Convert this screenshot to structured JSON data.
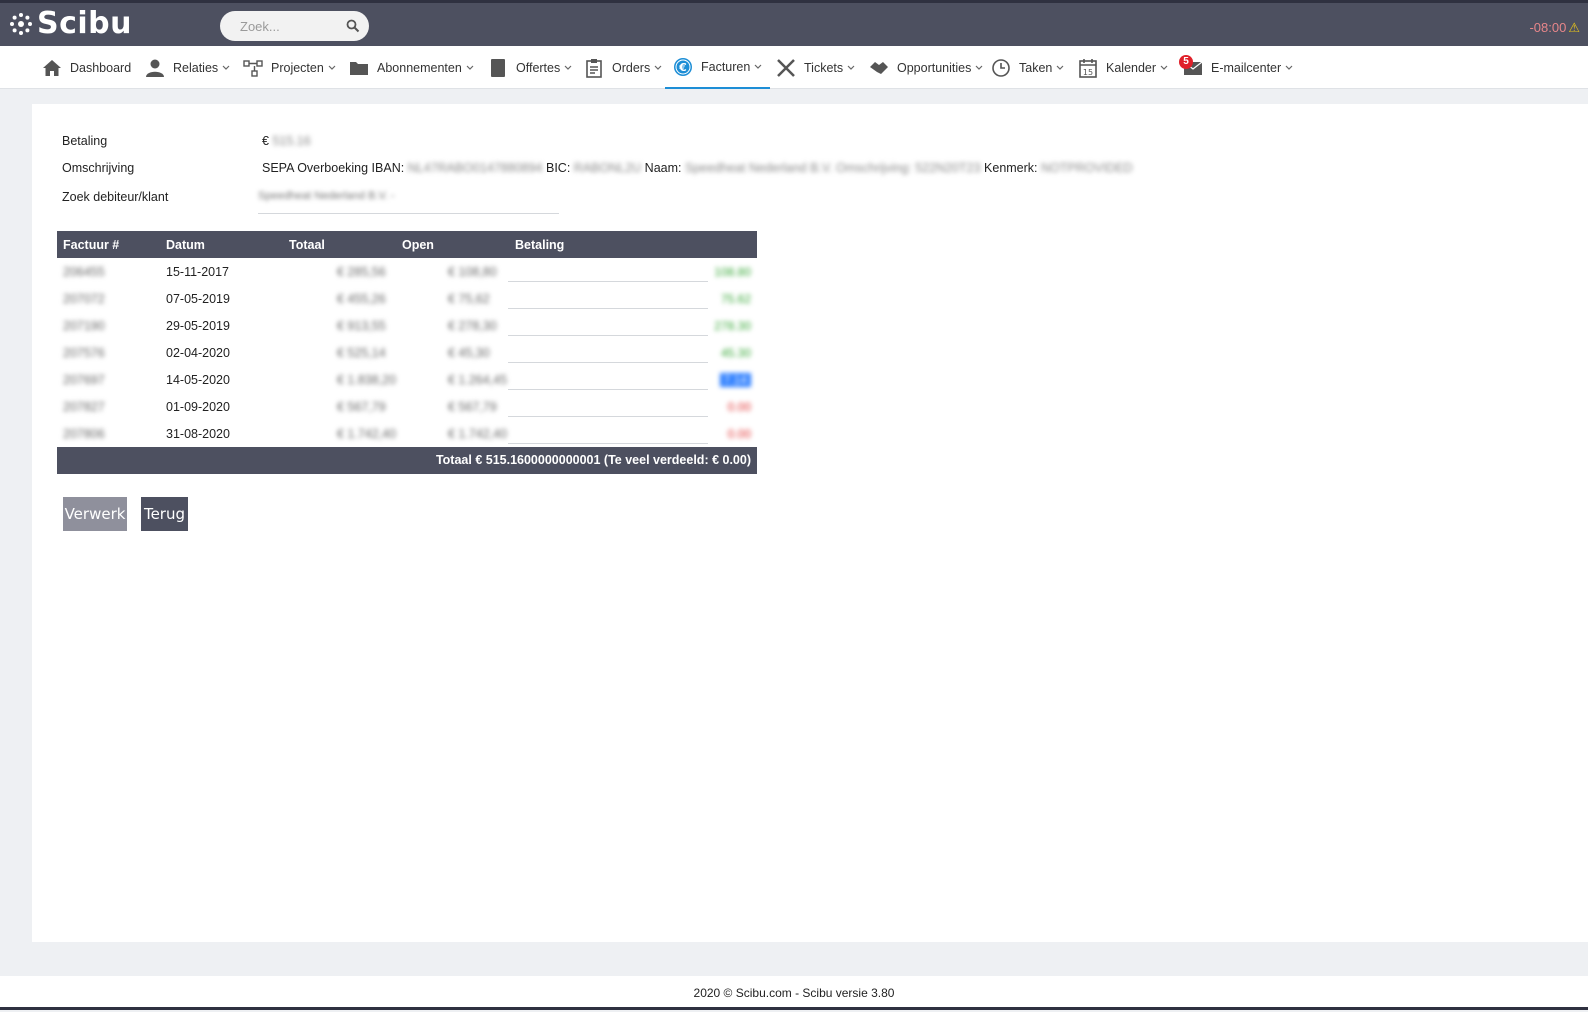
{
  "app": {
    "logo": "Scibu"
  },
  "search": {
    "placeholder": "Zoek..."
  },
  "header": {
    "time": "-08:00"
  },
  "nav": {
    "dashboard": "Dashboard",
    "relaties": "Relaties",
    "projecten": "Projecten",
    "abonnementen": "Abonnementen",
    "offertes": "Offertes",
    "orders": "Orders",
    "facturen": "Facturen",
    "tickets": "Tickets",
    "opportunities": "Opportunities",
    "taken": "Taken",
    "kalender": "Kalender",
    "emailcenter": "E-mailcenter",
    "email_badge": "5"
  },
  "form": {
    "betaling_label": "Betaling",
    "betaling_currency": "€",
    "betaling_value": "515.16",
    "omschrijving_label": "Omschrijving",
    "omschrijving_prefix": "SEPA Overboeking IBAN:",
    "iban": "NL47RABO0147880894",
    "bic_label": "BIC:",
    "bic": "RABONL2U",
    "naam_label": "Naam:",
    "naam": "Speedheat Nederland B.V. Omschrijving: 522N20T23",
    "kenmerk_label": "Kenmerk:",
    "kenmerk": "NOTPROVIDED",
    "zoek_label": "Zoek debiteur/klant",
    "zoek_value": "Speedheat Nederland B.V. -"
  },
  "table": {
    "headers": {
      "factuur": "Factuur #",
      "datum": "Datum",
      "totaal": "Totaal",
      "open": "Open",
      "betaling": "Betaling"
    },
    "rows": [
      {
        "factuur": "206455",
        "datum": "15-11-2017",
        "totaal": "€ 285,56",
        "open": "€ 108,80",
        "betaling": "108.80"
      },
      {
        "factuur": "207072",
        "datum": "07-05-2019",
        "totaal": "€ 455,26",
        "open": "€ 75,62",
        "betaling": "75.62"
      },
      {
        "factuur": "207190",
        "datum": "29-05-2019",
        "totaal": "€ 913,55",
        "open": "€ 278,30",
        "betaling": "278.30"
      },
      {
        "factuur": "207576",
        "datum": "02-04-2020",
        "totaal": "€ 525,14",
        "open": "€ 45,30",
        "betaling": "45.30"
      },
      {
        "factuur": "207697",
        "datum": "14-05-2020",
        "totaal": "€ 1.838,20",
        "open": "€ 1.264,45",
        "betaling": "7.14"
      },
      {
        "factuur": "207827",
        "datum": "01-09-2020",
        "totaal": "€ 567,79",
        "open": "€ 567,79",
        "betaling": "0.00"
      },
      {
        "factuur": "207806",
        "datum": "31-08-2020",
        "totaal": "€ 1.742,40",
        "open": "€ 1.742,40",
        "betaling": "0.00"
      }
    ],
    "footer": "Totaal € 515.1600000000001 (Te veel verdeeld: € 0.00)"
  },
  "buttons": {
    "verwerk": "Verwerk",
    "terug": "Terug"
  },
  "footer": {
    "text": "2020 © Scibu.com - Scibu versie 3.80"
  },
  "colors": {
    "header_bg": "#4d5060",
    "accent": "#1d8ed6",
    "green": "#31a531",
    "red": "#e03030"
  },
  "icons": [
    "logo-mark-icon",
    "search-icon",
    "home-icon",
    "user-icon",
    "project-icon",
    "folder-icon",
    "document-icon",
    "clipboard-icon",
    "euro-icon",
    "tools-icon",
    "handshake-icon",
    "clock-icon",
    "calendar-icon",
    "mail-icon",
    "chevron-down-icon",
    "warning-icon"
  ]
}
